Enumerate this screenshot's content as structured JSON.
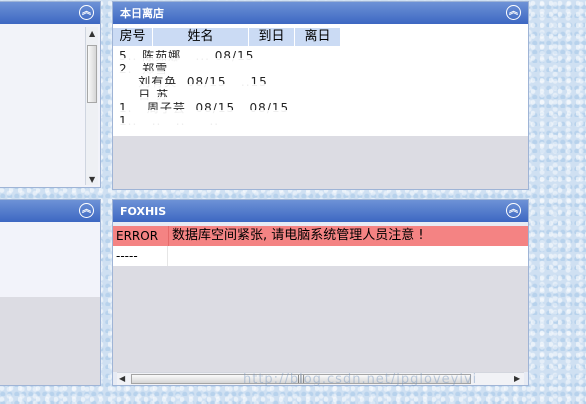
{
  "left_top_panel": {
    "toggle_icon": "double-chevron-up-icon"
  },
  "left_bottom_panel": {
    "toggle_icon": "double-chevron-up-icon"
  },
  "departure_panel": {
    "title": "本日离店",
    "columns": [
      "房号",
      "姓名",
      "到日",
      "离日"
    ],
    "obscured_rows_text": "5.. 陈茹娜   ... 08/15\n2.  郑雪 \n    刘有奂  08/15   ..15\n    日 苏\n1.   周子芸  08/15   08/15\n1..   ..   ..     ..\n    ..."
  },
  "foxhis_panel": {
    "title": "FOXHIS",
    "rows": [
      {
        "level": "ERROR",
        "message": "数据库空间紧张, 请电脑系统管理人员注意 !"
      },
      {
        "level": "-----",
        "message": ""
      }
    ]
  },
  "watermark": "http://blog.csdn.net/jpgloveyivi"
}
